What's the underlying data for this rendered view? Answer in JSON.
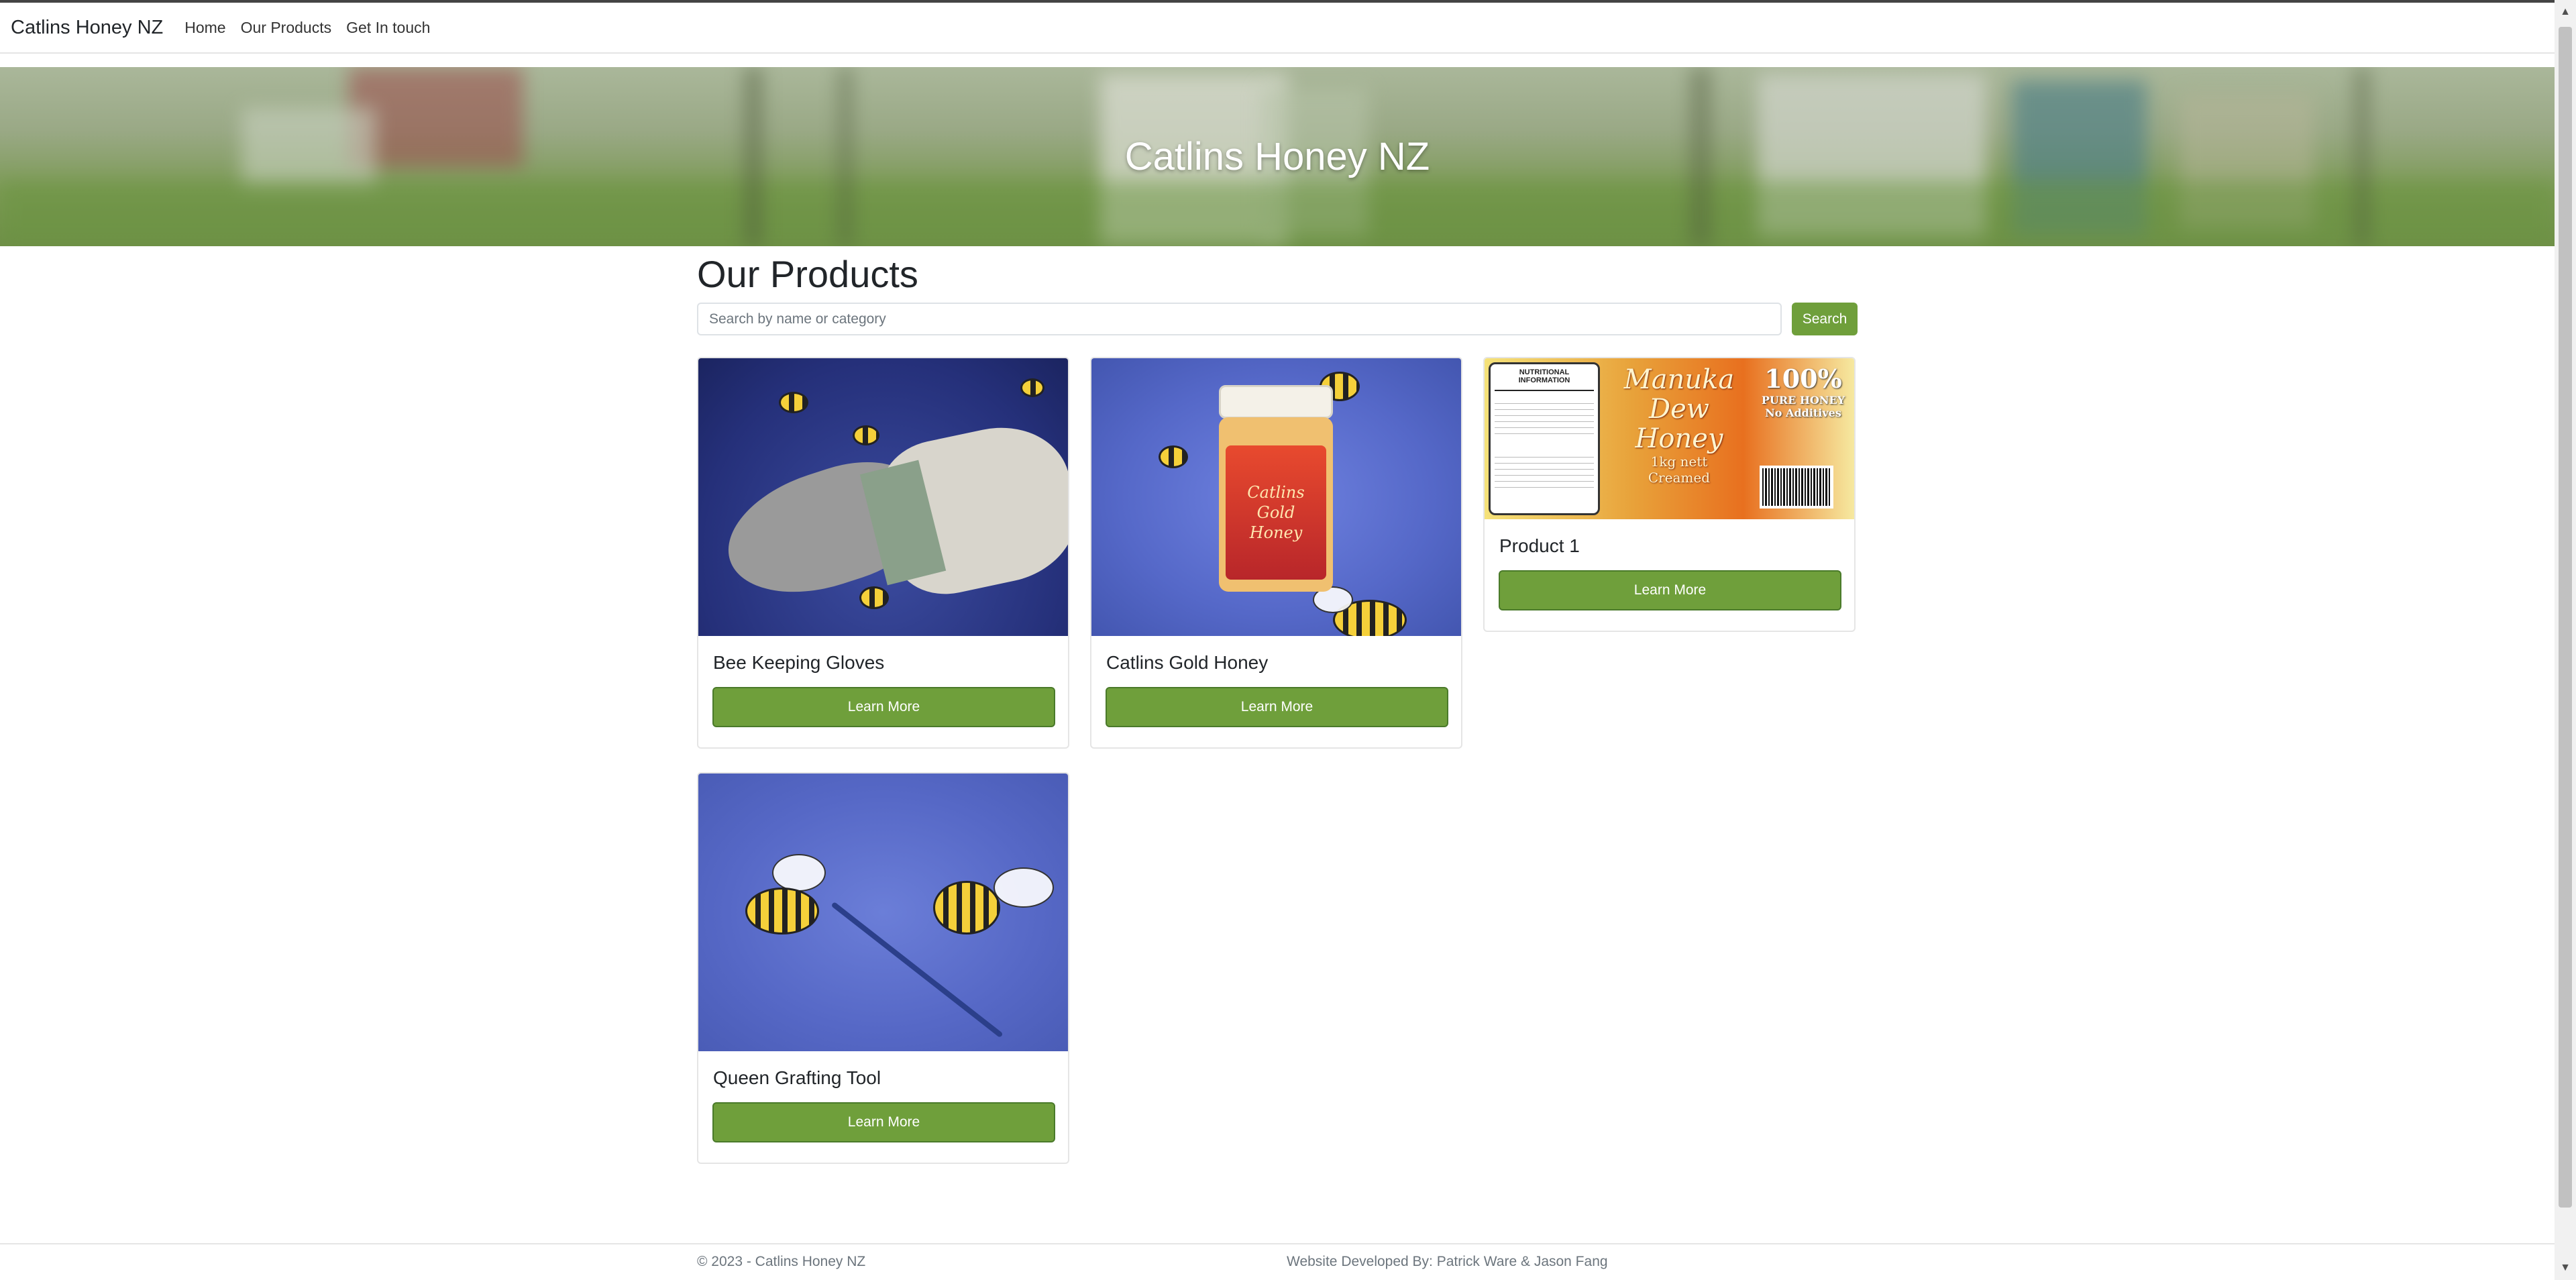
{
  "navbar": {
    "brand": "Catlins Honey NZ",
    "links": [
      "Home",
      "Our Products",
      "Get In touch"
    ]
  },
  "hero": {
    "title": "Catlins Honey NZ"
  },
  "main": {
    "title": "Our Products",
    "search": {
      "placeholder": "Search by name or category",
      "button": "Search"
    }
  },
  "products": [
    {
      "name": "Bee Keeping Gloves",
      "button": "Learn More",
      "image": "gloves-photo"
    },
    {
      "name": "Catlins Gold Honey",
      "button": "Learn More",
      "image": "honey-jar-photo"
    },
    {
      "name": "Product 1",
      "button": "Learn More",
      "image": "manuka-label"
    },
    {
      "name": "Queen Grafting Tool",
      "button": "Learn More",
      "image": "grafting-tool-photo"
    }
  ],
  "label": {
    "nutrition_heading": "NUTRITIONAL INFORMATION",
    "brand_line1": "Manuka",
    "brand_line2": "Dew",
    "brand_line3": "Honey",
    "weight": "1kg nett",
    "style": "Creamed",
    "percent": "100%",
    "pure": "PURE HONEY",
    "additives": "No Additives"
  },
  "jar_label": {
    "line1": "Catlins",
    "line2": "Gold",
    "line3": "Honey"
  },
  "footer": {
    "copyright": "© 2023 - Catlins Honey NZ",
    "credits": "Website Developed By: Patrick Ware & Jason Fang"
  },
  "colors": {
    "accent": "#6f9f3b",
    "fabric": "#5b6fc9"
  }
}
